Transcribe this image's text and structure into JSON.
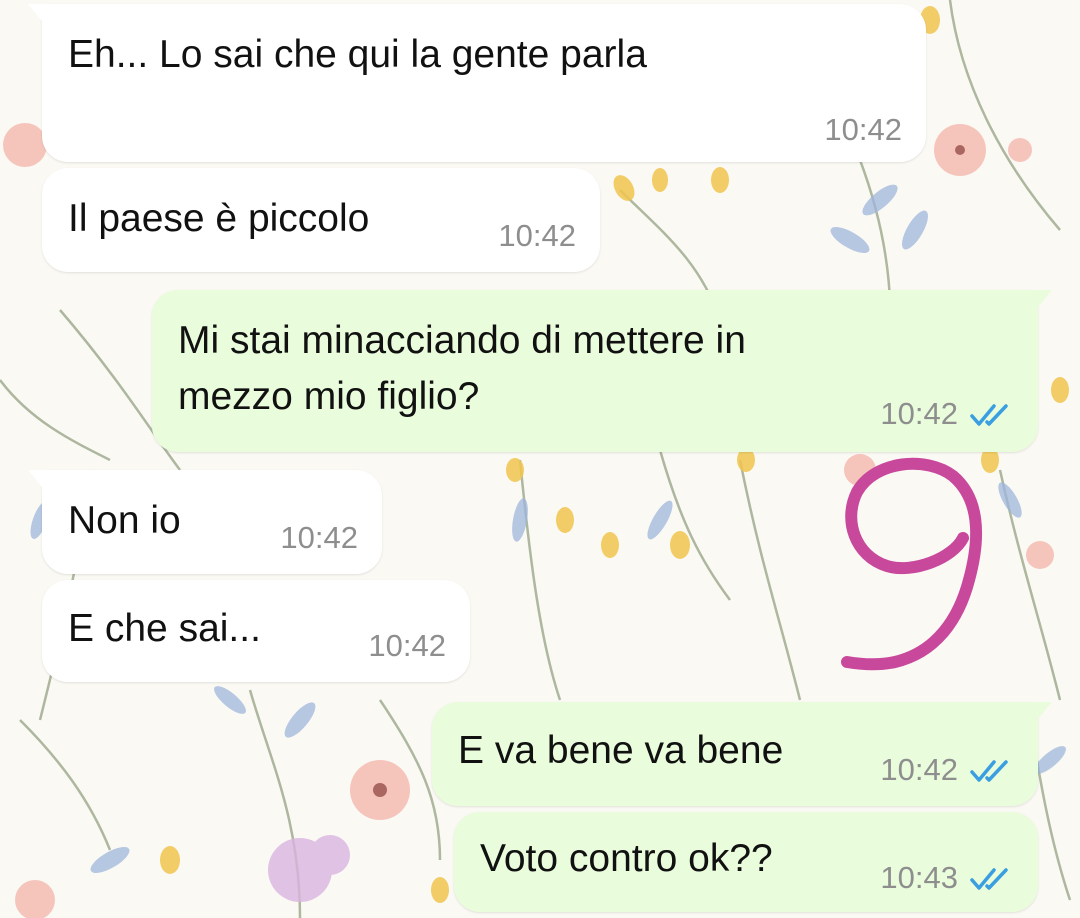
{
  "colors": {
    "incoming_bubble": "#ffffff",
    "outgoing_bubble": "#e9fcdc",
    "timestamp": "#8e8e8e",
    "read_ticks": "#3a9ee0",
    "annotation": "#c8489c"
  },
  "annotation": {
    "value": "9",
    "style": "hand-drawn magenta numeral"
  },
  "messages": [
    {
      "direction": "incoming",
      "text": "Eh... Lo sai che qui la gente parla",
      "time": "10:42"
    },
    {
      "direction": "incoming",
      "text": "Il paese è piccolo",
      "time": "10:42"
    },
    {
      "direction": "outgoing",
      "text_line1": "Mi stai minacciando di mettere in",
      "text_line2": "mezzo mio figlio?",
      "time": "10:42",
      "status_icon": "double-check-read-icon"
    },
    {
      "direction": "incoming",
      "text": "Non io",
      "time": "10:42"
    },
    {
      "direction": "incoming",
      "text": "E che sai...",
      "time": "10:42"
    },
    {
      "direction": "outgoing",
      "text": "E va bene va bene",
      "time": "10:42",
      "status_icon": "double-check-read-icon"
    },
    {
      "direction": "outgoing",
      "text": "Voto contro ok??",
      "time": "10:43",
      "status_icon": "double-check-read-icon"
    }
  ]
}
